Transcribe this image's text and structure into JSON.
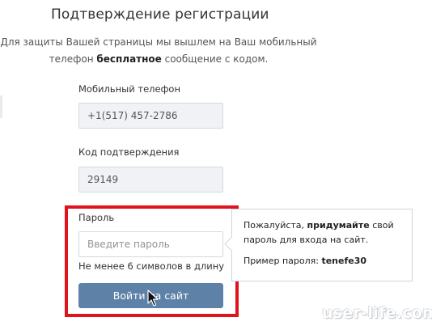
{
  "page": {
    "title": "Подтверждение регистрации",
    "description_part1": "Для защиты Вашей страницы мы вышлем на Ваш мобильный телефон ",
    "description_bold": "бесплатное",
    "description_part2": " сообщение с кодом."
  },
  "phone": {
    "label": "Мобильный телефон",
    "value": "+1(517) 457-2786"
  },
  "code": {
    "label": "Код подтверждения",
    "value": "29149"
  },
  "password": {
    "label": "Пароль",
    "value": "",
    "placeholder": "Введите пароль",
    "hint": "Не менее 6 символов в длину"
  },
  "login_button": {
    "label": "Войти на сайт"
  },
  "tooltip": {
    "line1_part1": "Пожалуйста, ",
    "line1_bold": "придумайте",
    "line1_part2": " свой пароль для входа на сайт.",
    "example_prefix": "Пример пароля: ",
    "example_value": "tenefe30"
  },
  "colors": {
    "highlight_frame": "#e0121b",
    "button": "#5e81a8"
  },
  "icons": {
    "cursor": "mouse-pointer-icon"
  },
  "watermark": "user-life.com"
}
